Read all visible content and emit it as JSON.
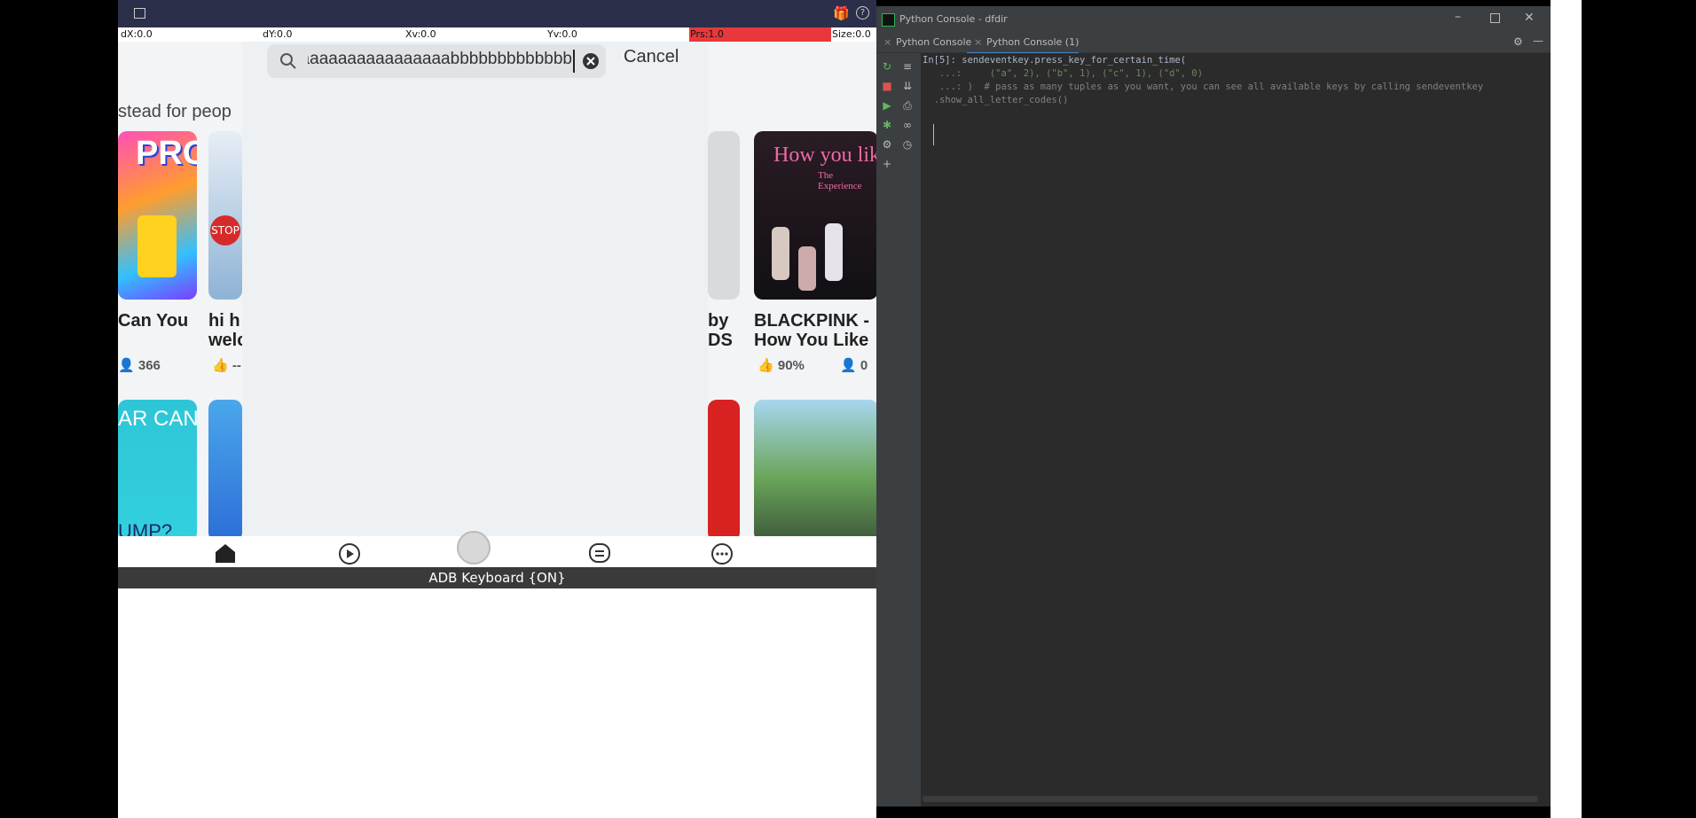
{
  "emulator": {
    "stats": {
      "dx": "dX:0.0",
      "dy": "dY:0.0",
      "xv": "Xv:0.0",
      "yv": "Yv:0.0",
      "prs": "Prs:1.0",
      "size": "Size:0.0"
    },
    "search": {
      "query": "aaaaaaaaaaaaaaaaaabbbbbbbbbbbbb",
      "cancel_label": "Cancel"
    },
    "section_heading": "stead for peop",
    "games_row1": [
      {
        "title": "Can You",
        "meta": "366"
      },
      {
        "title_line1": "hi h",
        "title_line2": "welc",
        "meta": "--"
      },
      {
        "title_line1": "by",
        "title_line2": "DS"
      },
      {
        "title_line1": "BLACKPINK -",
        "title_line2": "How You Like",
        "meta_rating": "90%",
        "meta_players": "0"
      }
    ],
    "thumb_texts": {
      "pro": "PRO",
      "stop": "STOP",
      "how_you_like": "How you like",
      "experience": "The Experience",
      "ar_can": "AR CAN",
      "jump": "UMP?"
    },
    "keyboard_label": "ADB Keyboard {ON}"
  },
  "pycharm": {
    "window_title": "Python Console - dfdir",
    "tabs": [
      "Python Console",
      "Python Console (1)"
    ],
    "code_lines": [
      "In[5]: sendeventkey.press_key_for_certain_time(",
      "   ...:     (\"a\", 2), (\"b\", 1), (\"c\", 1), (\"d\", 0)",
      "   ...: )  # pass as many tuples as you want, you can see all available keys by calling sendeventkey",
      "  .show_all_letter_codes()"
    ]
  },
  "colors": {
    "emu_bar": "#2b2f4a",
    "prs_bar": "#e8383b",
    "ide_bg": "#2b2b2b",
    "ide_panel": "#3c3f41"
  }
}
